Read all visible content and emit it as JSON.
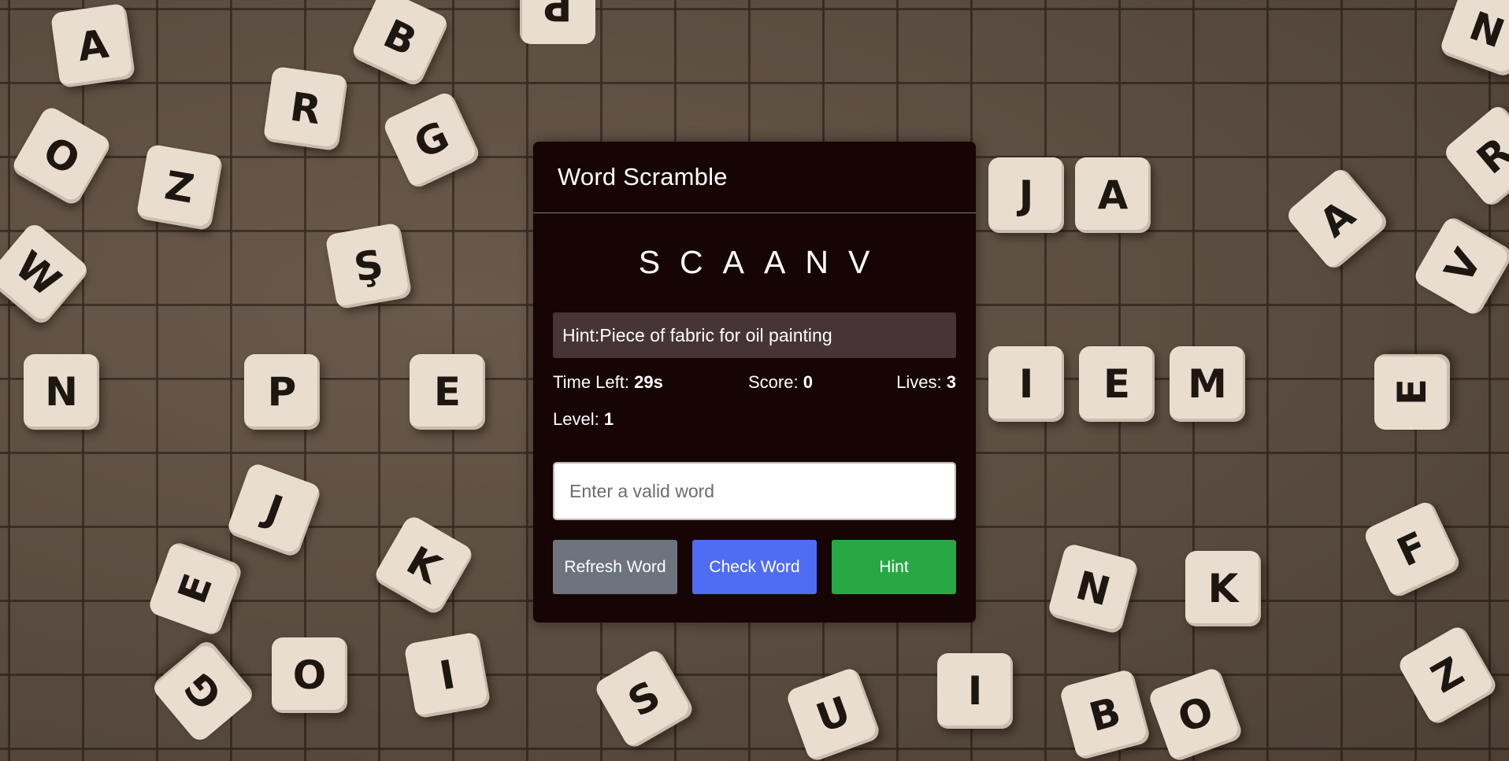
{
  "game": {
    "title": "Word Scramble",
    "scrambled_letters": "SCAANV",
    "hint_prefix": "Hint: ",
    "hint_text": "Piece of fabric for oil painting",
    "time_label": "Time Left: ",
    "time_value": "29s",
    "score_label": "Score: ",
    "score_value": "0",
    "lives_label": "Lives: ",
    "lives_value": "3",
    "level_label": "Level: ",
    "level_value": "1",
    "input": {
      "value": "",
      "placeholder": "Enter a valid word"
    },
    "buttons": {
      "refresh": "Refresh Word",
      "check": "Check Word",
      "hint": "Hint"
    }
  },
  "background_tiles": [
    "A",
    "B",
    "P",
    "N",
    "R",
    "G",
    "O",
    "Z",
    "Ş",
    "W",
    "J",
    "A",
    "N",
    "P",
    "E",
    "I",
    "E",
    "M",
    "E",
    "J",
    "E",
    "K",
    "N",
    "K",
    "F",
    "G",
    "O",
    "I",
    "S",
    "U",
    "I",
    "B",
    "O",
    "Z",
    "A",
    "V",
    "R"
  ],
  "colors": {
    "card_background": "#170404",
    "hint_background": "#463436",
    "refresh_button": "#6c757d",
    "check_button": "#4f6df2",
    "hint_button": "#28a745"
  }
}
